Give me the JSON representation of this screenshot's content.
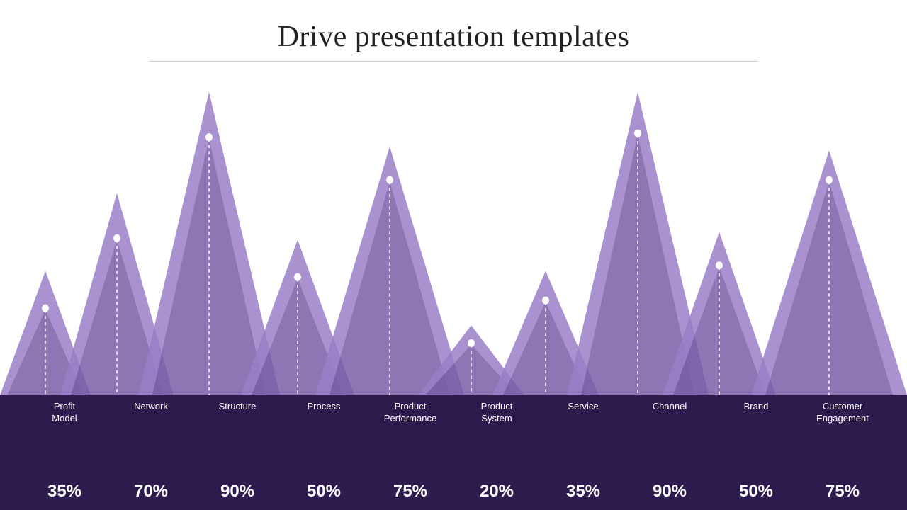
{
  "title": "Drive presentation templates",
  "categories": [
    {
      "label": "Profit\nModel",
      "percentage": "35%",
      "height_pct": 0.38
    },
    {
      "label": "Network",
      "percentage": "70%",
      "height_pct": 0.6
    },
    {
      "label": "Structure",
      "percentage": "90%",
      "height_pct": 0.88
    },
    {
      "label": "Process",
      "percentage": "50%",
      "height_pct": 0.48
    },
    {
      "label": "Product\nPerformance",
      "percentage": "75%",
      "height_pct": 0.72
    },
    {
      "label": "Product\nSystem",
      "percentage": "20%",
      "height_pct": 0.28
    },
    {
      "label": "Service",
      "percentage": "35%",
      "height_pct": 0.38
    },
    {
      "label": "Channel",
      "percentage": "90%",
      "height_pct": 0.88
    },
    {
      "label": "Brand",
      "percentage": "50%",
      "height_pct": 0.5
    },
    {
      "label": "Customer\nEngagement",
      "percentage": "75%",
      "height_pct": 0.72
    }
  ],
  "colors": {
    "mountain_back": "#9b7fc7",
    "mountain_front": "#7b5ea7",
    "mountain_mid": "#8b6db7",
    "dark_bg": "#2d1b4e",
    "dot_color": "#ffffff"
  }
}
